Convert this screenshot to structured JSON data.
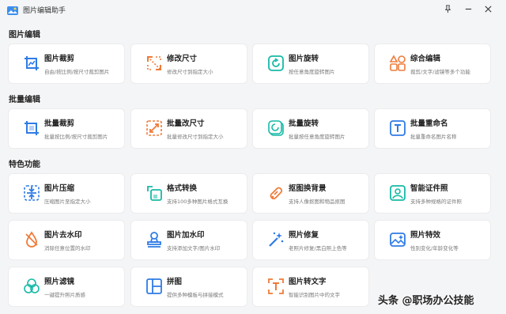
{
  "window": {
    "title": "图片编辑助手",
    "icons": [
      "app-logo-icon",
      "pin-icon",
      "minimize-icon",
      "close-icon"
    ]
  },
  "sections": {
    "single": "图片编辑",
    "batch": "批量编辑",
    "features": "特色功能"
  },
  "single_cards": [
    {
      "name": "图片裁剪",
      "desc": "自由/按比例/按尺寸裁剪图片",
      "icon": "crop-icon"
    },
    {
      "name": "修改尺寸",
      "desc": "修改尺寸到指定大小",
      "icon": "resize-icon"
    },
    {
      "name": "图片旋转",
      "desc": "按任意角度旋转图片",
      "icon": "rotate-icon"
    },
    {
      "name": "综合编辑",
      "desc": "裁剪/文字/滤镜等多个功能",
      "icon": "grid-edit-icon"
    }
  ],
  "batch_cards": [
    {
      "name": "批量裁剪",
      "desc": "批量按比例/按尺寸裁剪图片",
      "icon": "crop-icon"
    },
    {
      "name": "批量改尺寸",
      "desc": "批量修改尺寸到指定大小",
      "icon": "resize-icon"
    },
    {
      "name": "批量旋转",
      "desc": "批量按任意角度旋转图片",
      "icon": "rotate-icon"
    },
    {
      "name": "批量重命名",
      "desc": "批量重命名图片名称",
      "icon": "text-icon"
    }
  ],
  "feature_cards": [
    {
      "name": "图片压缩",
      "desc": "压缩图片至指定大小",
      "icon": "compress-icon"
    },
    {
      "name": "格式转换",
      "desc": "支持100多种图片格式互换",
      "icon": "convert-icon"
    },
    {
      "name": "抠图换背景",
      "desc": "支持人像抠图和物品抠图",
      "icon": "cutout-icon"
    },
    {
      "name": "智能证件照",
      "desc": "支持多种规格的证件照",
      "icon": "id-photo-icon"
    },
    {
      "name": "图片去水印",
      "desc": "消除任意位置的水印",
      "icon": "drop-icon"
    },
    {
      "name": "图片加水印",
      "desc": "支持添加文字/图片水印",
      "icon": "stamp-icon"
    },
    {
      "name": "照片修复",
      "desc": "老照片修复/黑白照上色等",
      "icon": "magic-wand-icon"
    },
    {
      "name": "照片特效",
      "desc": "性别变化/年龄变化等",
      "icon": "image-effect-icon"
    },
    {
      "name": "照片滤镜",
      "desc": "一键提升照片质感",
      "icon": "filter-icon"
    },
    {
      "name": "拼图",
      "desc": "提供多种模板与拼接模式",
      "icon": "collage-icon"
    },
    {
      "name": "图片转文字",
      "desc": "智能识别图片中的文字",
      "icon": "ocr-icon"
    }
  ],
  "watermark": "头条 @职场办公技能",
  "colors": {
    "blue": "#2f7be5",
    "orange": "#ef7b3a",
    "teal": "#16b9a6"
  }
}
